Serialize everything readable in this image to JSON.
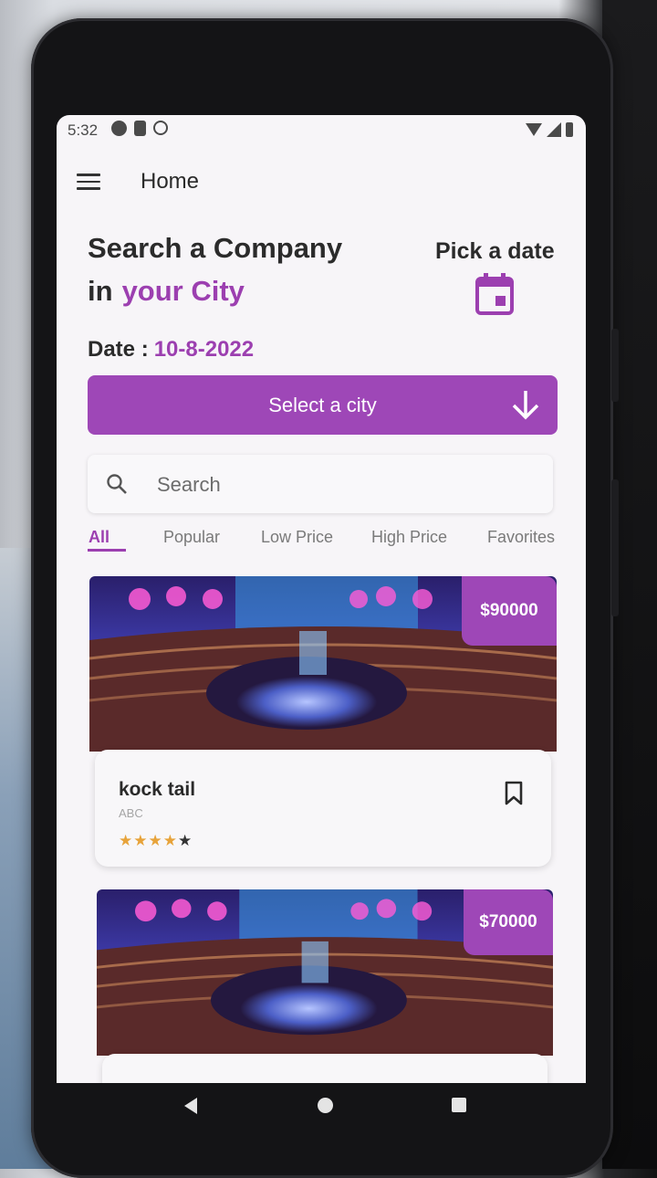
{
  "status_bar": {
    "time": "5:32"
  },
  "app_bar": {
    "title": "Home"
  },
  "hero": {
    "line1": "Search a Company",
    "line2_prefix": "in",
    "line2_accent": "your City",
    "pick_date_label": "Pick a date"
  },
  "date": {
    "label": "Date :",
    "value": "10-8-2022"
  },
  "city_button": {
    "label": "Select a city"
  },
  "search": {
    "placeholder": "Search"
  },
  "tabs": [
    {
      "label": "All",
      "active": true
    },
    {
      "label": "Popular"
    },
    {
      "label": "Low Price"
    },
    {
      "label": "High Price"
    },
    {
      "label": "Favorites"
    }
  ],
  "cards": [
    {
      "price": "$90000",
      "title": "kock tail",
      "subtitle": "ABC",
      "rating": 4
    },
    {
      "price": "$70000"
    }
  ],
  "colors": {
    "accent": "#9e47b7",
    "accent_text": "#9c3fb0",
    "star": "#e7a33a"
  },
  "icons": [
    "menu-icon",
    "calendar-icon",
    "arrow-down-icon",
    "search-icon",
    "bookmark-icon",
    "star-icon"
  ]
}
